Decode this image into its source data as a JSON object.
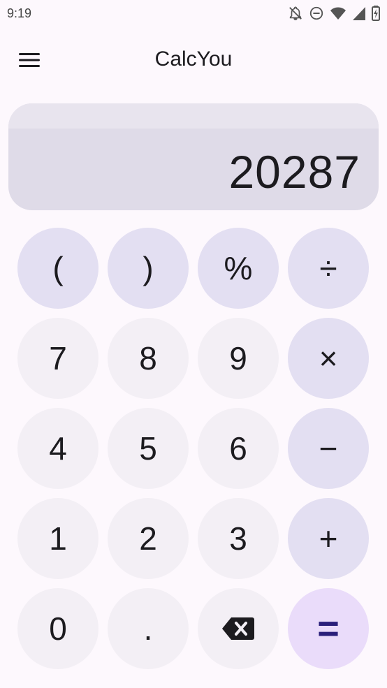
{
  "status_bar": {
    "time": "9:19",
    "icons": [
      "notifications-off-icon",
      "do-not-disturb-icon",
      "wifi-icon",
      "cell-signal-icon",
      "battery-icon"
    ]
  },
  "app_bar": {
    "title": "CalcYou",
    "menu_icon": "menu-icon"
  },
  "display": {
    "value": "20287"
  },
  "keypad": {
    "open_paren": "(",
    "close_paren": ")",
    "percent": "%",
    "divide": "÷",
    "seven": "7",
    "eight": "8",
    "nine": "9",
    "multiply": "×",
    "four": "4",
    "five": "5",
    "six": "6",
    "minus": "−",
    "one": "1",
    "two": "2",
    "three": "3",
    "plus": "+",
    "zero": "0",
    "decimal": ".",
    "backspace_icon": "backspace-icon",
    "equals": "="
  },
  "colors": {
    "background": "#fdf8fd",
    "number_key": "#f3eff5",
    "operator_key": "#e3dff2",
    "equals_key": "#eadcfa",
    "display": "#dfdbe8"
  }
}
